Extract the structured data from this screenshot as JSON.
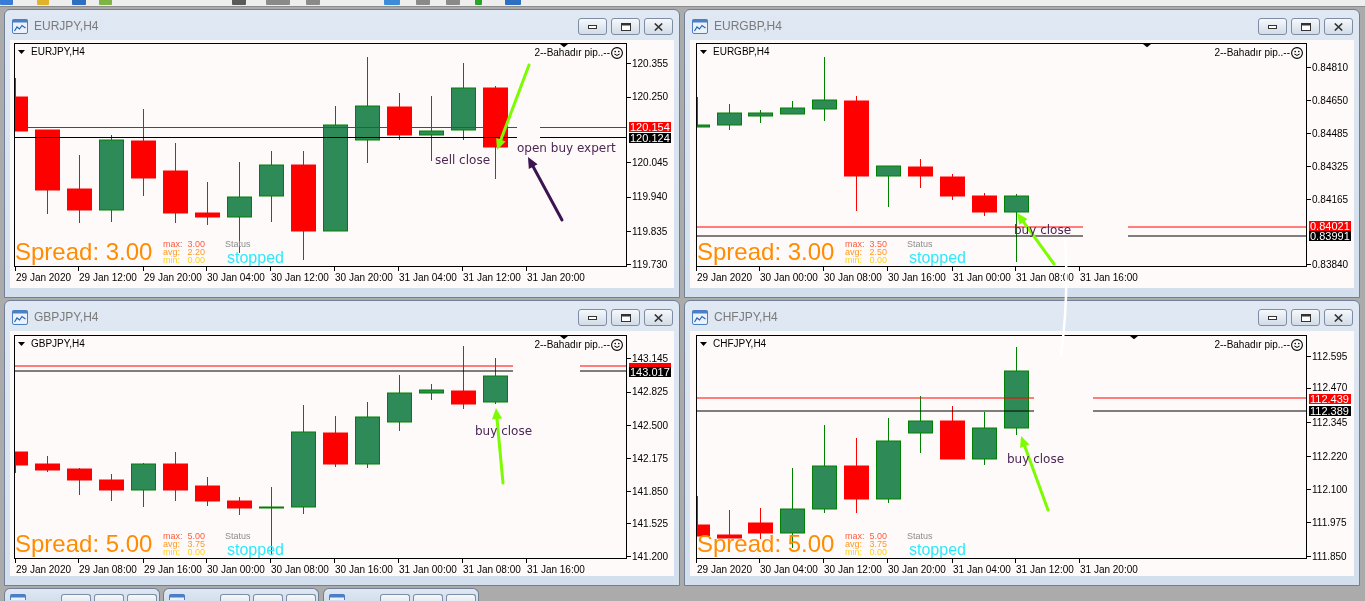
{
  "windows": [
    {
      "title": "EURJPY,H4",
      "symbol": "EURJPY,H4",
      "indicator": "2--Bahadır pip..--",
      "price_axis": [
        "120.355",
        "120.250",
        "120.045",
        "119.940",
        "119.835",
        "119.730"
      ],
      "time_axis": [
        "29 Jan 2020",
        "29 Jan 12:00",
        "29 Jan 20:00",
        "30 Jan 04:00",
        "30 Jan 12:00",
        "30 Jan 20:00",
        "31 Jan 04:00",
        "31 Jan 12:00",
        "31 Jan 20:00"
      ],
      "ask_price": "120.154",
      "bid_price": "120.124",
      "spread": "Spread: 3.00",
      "stats": [
        {
          "label": "max:",
          "value": "3.00"
        },
        {
          "label": "avg:",
          "value": "2.20"
        },
        {
          "label": "min:",
          "value": "0.00"
        }
      ],
      "status_label": "Status",
      "status": "stopped",
      "annotations": [
        "sell close",
        "open buy expert"
      ]
    },
    {
      "title": "EURGBP,H4",
      "symbol": "EURGBP,H4",
      "indicator": "2--Bahadır pip..--",
      "price_axis": [
        "0.84810",
        "0.84650",
        "0.84485",
        "0.84325",
        "0.84165",
        "0.83840"
      ],
      "time_axis": [
        "29 Jan 2020",
        "30 Jan 00:00",
        "30 Jan 08:00",
        "30 Jan 16:00",
        "31 Jan 00:00",
        "31 Jan 08:00",
        "31 Jan 16:00"
      ],
      "ask_price": "0.84021",
      "bid_price": "0.83991",
      "spread": "Spread: 3.00",
      "stats": [
        {
          "label": "max:",
          "value": "3.50"
        },
        {
          "label": "avg:",
          "value": "2.50"
        },
        {
          "label": "min:",
          "value": "0.00"
        }
      ],
      "status_label": "Status",
      "status": "stopped",
      "annotations": [
        "buy close"
      ]
    },
    {
      "title": "GBPJPY,H4",
      "symbol": "GBPJPY,H4",
      "indicator": "2--Bahadır pip..--",
      "price_axis": [
        "143.145",
        "142.825",
        "142.500",
        "142.175",
        "141.850",
        "141.525",
        "141.200"
      ],
      "time_axis": [
        "29 Jan 2020",
        "29 Jan 08:00",
        "29 Jan 16:00",
        "30 Jan 00:00",
        "30 Jan 08:00",
        "30 Jan 16:00",
        "31 Jan 00:00",
        "31 Jan 08:00",
        "31 Jan 16:00"
      ],
      "bid_price": "143.017",
      "spread": "Spread: 5.00",
      "stats": [
        {
          "label": "max:",
          "value": "5.00"
        },
        {
          "label": "avg:",
          "value": "3.75"
        },
        {
          "label": "min:",
          "value": "0.00"
        }
      ],
      "status_label": "Status",
      "status": "stopped",
      "annotations": [
        "buy close"
      ]
    },
    {
      "title": "CHFJPY,H4",
      "symbol": "CHFJPY,H4",
      "indicator": "2--Bahadır pip..--",
      "price_axis": [
        "112.595",
        "112.470",
        "112.345",
        "112.220",
        "112.100",
        "111.975",
        "111.850"
      ],
      "time_axis": [
        "29 Jan 2020",
        "30 Jan 04:00",
        "30 Jan 12:00",
        "30 Jan 20:00",
        "31 Jan 04:00",
        "31 Jan 12:00",
        "31 Jan 20:00"
      ],
      "ask_price": "112.439",
      "bid_price": "112.389",
      "spread": "Spread: 5.00",
      "stats": [
        {
          "label": "max:",
          "value": "5.00"
        },
        {
          "label": "avg:",
          "value": "3.75"
        },
        {
          "label": "min:",
          "value": "0.00"
        }
      ],
      "status_label": "Status",
      "status": "stopped",
      "annotations": [
        "buy close"
      ]
    }
  ]
}
